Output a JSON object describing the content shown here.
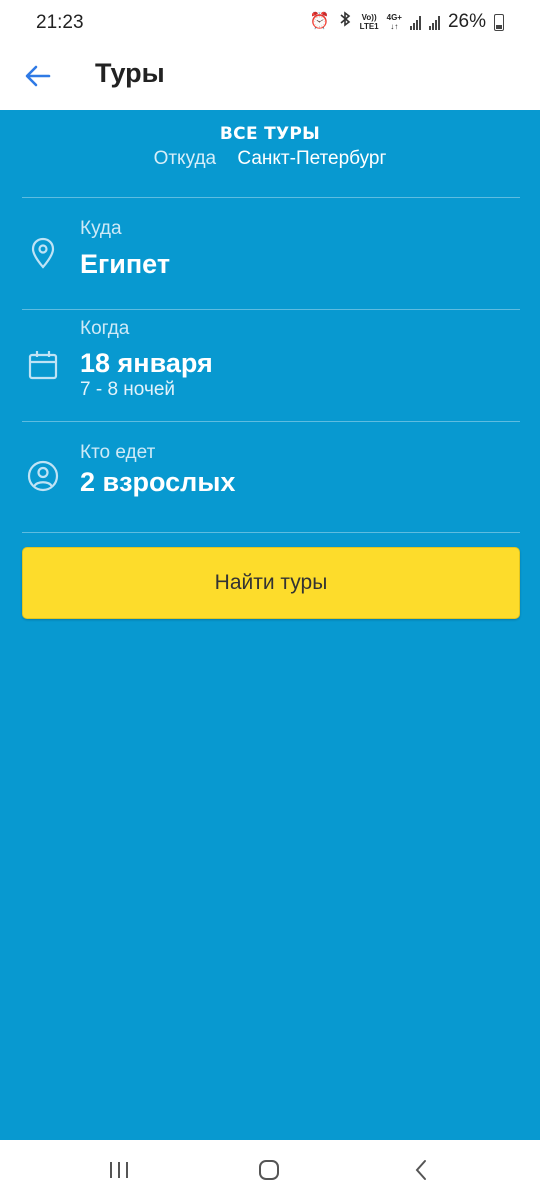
{
  "status_bar": {
    "time": "21:23",
    "volte_line1": "Vo))",
    "volte_line2": "LTE1",
    "network_line1": "4G+",
    "network_line2": "↓↑",
    "battery_percent": "26%"
  },
  "app_bar": {
    "title": "Туры",
    "back_icon": "arrow-left-icon"
  },
  "search_form": {
    "heading": "ВСЕ ТУРЫ",
    "from_label": "Откуда",
    "from_value": "Санкт-Петербург",
    "destination": {
      "label": "Куда",
      "value": "Египет",
      "icon": "location-pin-icon"
    },
    "dates": {
      "label": "Когда",
      "value": "18 января",
      "sub": "7 - 8 ночей",
      "icon": "calendar-icon"
    },
    "travelers": {
      "label": "Кто едет",
      "value": "2 взрослых",
      "icon": "person-icon"
    },
    "search_button": "Найти туры"
  },
  "colors": {
    "background": "#0899d0",
    "button": "#fddc2b",
    "accent": "#2f7ae5"
  },
  "nav_bar": {
    "icons": [
      "recent-apps-icon",
      "home-icon",
      "back-icon"
    ]
  }
}
